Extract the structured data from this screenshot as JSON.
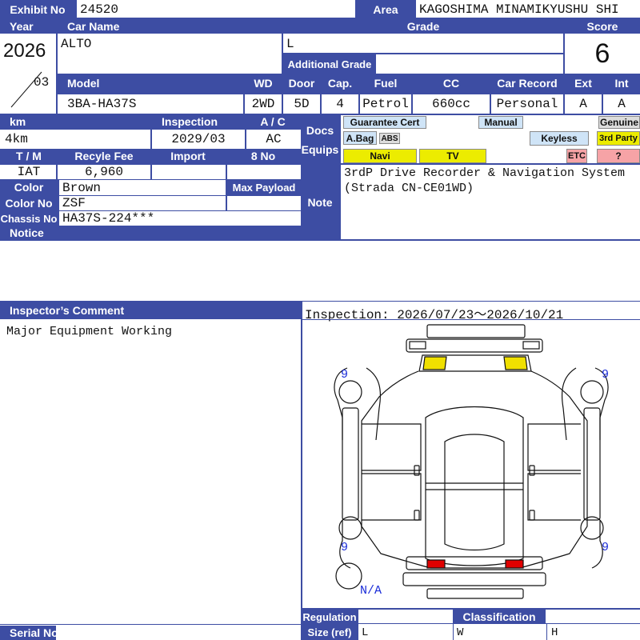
{
  "header": {
    "exhibit_label": "Exhibit No",
    "exhibit_value": "24520",
    "area_label": "Area",
    "area_value": "KAGOSHIMA MINAMIKYUSHU SHI",
    "year_label": "Year",
    "year_value": "2026",
    "month_value": "03",
    "car_name_label": "Car Name",
    "car_name_value": "ALTO",
    "grade_label": "Grade",
    "grade_value": "L",
    "additional_grade_label": "Additional Grade",
    "score_label": "Score",
    "score_value": "6"
  },
  "specs": {
    "labels": [
      "Model",
      "WD",
      "Door",
      "Cap.",
      "Fuel",
      "CC",
      "Car Record",
      "Ext",
      "Int"
    ],
    "values": [
      "3BA-HA37S",
      "2WD",
      "5D",
      "4",
      "Petrol",
      "660cc",
      "Personal",
      "A",
      "A"
    ]
  },
  "details": {
    "km_label": "km",
    "km_value": "4km",
    "inspection_label": "Inspection",
    "inspection_value": "2029/03",
    "ac_label": "A / C",
    "ac_value": "AC",
    "tm_label": "T / M",
    "tm_value": "IAT",
    "recycle_label": "Recyle Fee",
    "recycle_value": "6,960",
    "import_label": "Import",
    "import_value": "",
    "eightno_label": "8 No",
    "eightno_value": "",
    "color_label": "Color",
    "color_value": "Brown",
    "maxpayload_label": "Max Payload",
    "colorno_label": "Color No",
    "colorno_value": "ZSF",
    "chassis_label": "Chassis No",
    "chassis_value": "HA37S-224***",
    "notice_label": "Notice"
  },
  "docs": {
    "docs_label": "Docs",
    "equips_label": "Equips",
    "chips": {
      "guarantee": "Guarantee Cert",
      "manual": "Manual",
      "genuine": "Genuine",
      "abag": "A.Bag",
      "abs": "ABS",
      "keyless": "Keyless",
      "third_party": "3rd Party",
      "navi": "Navi",
      "tv": "TV",
      "etc": "ETC",
      "unknown": "?"
    },
    "chip_colors": {
      "highlight": "#ecec00",
      "blue": "#cfe4f7",
      "gray": "#dcdcdc",
      "pink": "#f6a3a6"
    }
  },
  "note": {
    "label": "Note",
    "text": "3rdP Drive Recorder & Navigation System (Strada CN-CE01WD)"
  },
  "inspector": {
    "label": "Inspector’s Comment",
    "comment": "Major Equipment Working",
    "period": "Inspection: 2026/07/23～2026/10/21"
  },
  "diagram": {
    "tire_labels": [
      "9",
      "9",
      "9",
      "9"
    ],
    "spare_label": "N/A",
    "marker_colors": {
      "front_lights": "#f0e000",
      "rear_lights": "#e00000"
    }
  },
  "footer": {
    "serial_label": "Serial No",
    "serial_value": "",
    "regulation_label": "Regulation",
    "size_label": "Size (ref)",
    "classification_label": "Classification",
    "size_l": "L",
    "size_w": "W",
    "size_h": "H"
  },
  "theme": {
    "header_bg": "#3d4da3",
    "header_text": "#ffffff"
  }
}
